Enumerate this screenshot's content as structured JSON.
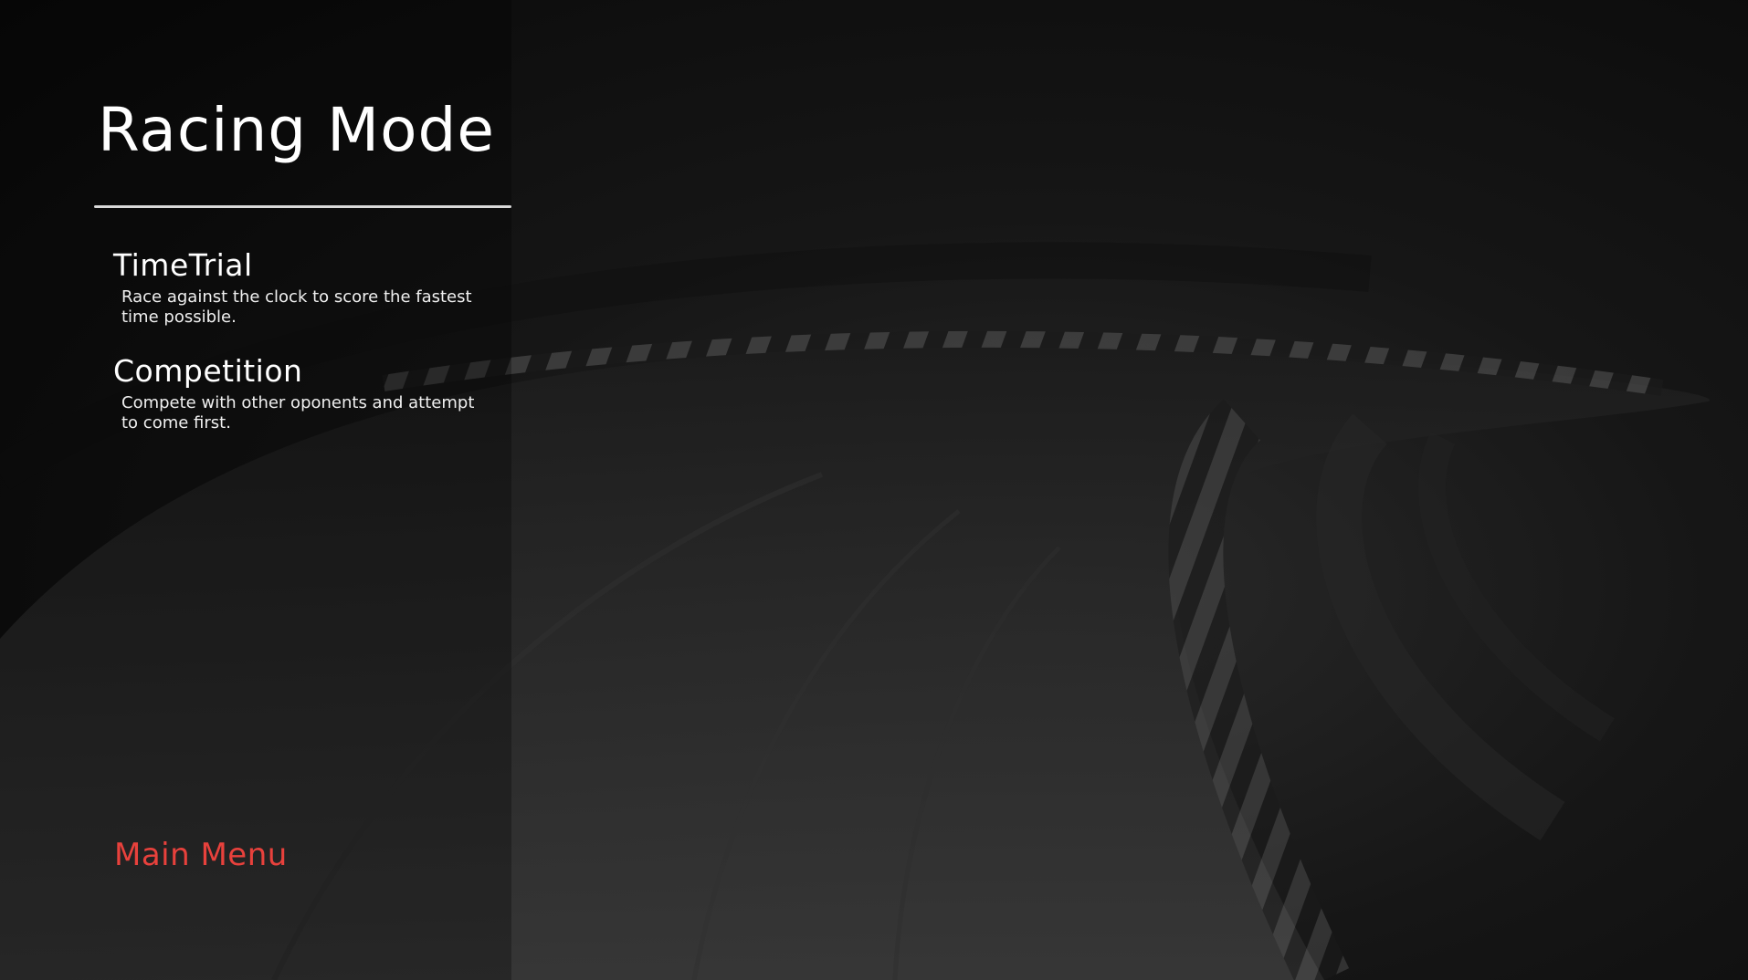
{
  "screen": {
    "title": "Racing Mode"
  },
  "modes": [
    {
      "name": "TimeTrial",
      "description": "Race against the clock to score the fastest time possible."
    },
    {
      "name": "Competition",
      "description": "Compete with other oponents and attempt to come first."
    }
  ],
  "navigation": {
    "main_menu_label": "Main Menu"
  },
  "colors": {
    "title": "#ffffff",
    "divider": "#d9d9d9",
    "main_menu": "#e8413c",
    "background": "#0b0b0b"
  }
}
